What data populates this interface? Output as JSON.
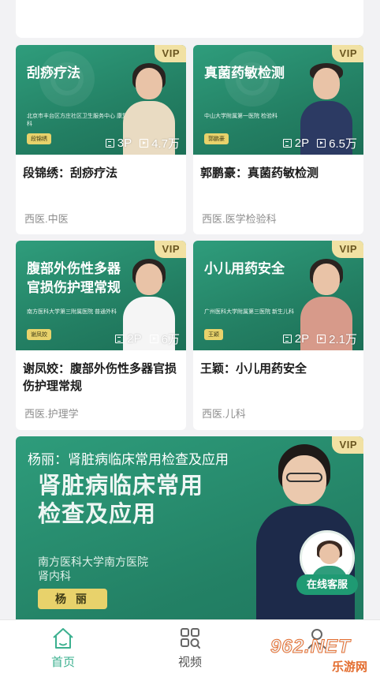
{
  "courses": [
    {
      "thumb_title": "刮痧疗法",
      "thumb_hospital": "北京市丰台区方庄社区卫生服务中心 康复科",
      "thumb_doctor": "段锦绣",
      "vip": "VIP",
      "parts": "3P",
      "views": "4.7万",
      "title": "段锦绣：刮痧疗法",
      "category": "西医.中医",
      "doctor_color": "#e9dbc2"
    },
    {
      "thumb_title": "真菌药敏检测",
      "thumb_hospital": "中山大学附属第一医院 检验科",
      "thumb_doctor": "郭鹏豪",
      "vip": "VIP",
      "parts": "2P",
      "views": "6.5万",
      "title": "郭鹏豪：真菌药敏检测",
      "category": "西医.医学检验科",
      "doctor_color": "#2c3a63"
    },
    {
      "thumb_title": "腹部外伤性多器官损伤护理常规",
      "thumb_hospital": "南方医科大学第三附属医院 普通外科",
      "thumb_doctor": "谢凤姣",
      "vip": "VIP",
      "parts": "2P",
      "views": "6万",
      "title": "谢凤姣：腹部外伤性多器官损伤护理常规",
      "category": "西医.护理学",
      "doctor_color": "#f5f5f5"
    },
    {
      "thumb_title": "小儿用药安全",
      "thumb_hospital": "广州医科大学附属第三医院 新生儿科",
      "thumb_doctor": "王颖",
      "vip": "VIP",
      "parts": "2P",
      "views": "2.1万",
      "title": "王颖：小儿用药安全",
      "category": "西医.儿科",
      "doctor_color": "#d79a8a"
    }
  ],
  "banner": {
    "top_title": "杨丽：肾脏病临床常用检查及应用",
    "big_title_line1": "肾脏病临床常用",
    "big_title_line2": "检查及应用",
    "hospital_line1": "南方医科大学南方医院",
    "hospital_line2": "肾内科",
    "doctor": "杨 丽",
    "vip": "VIP"
  },
  "customer_service": {
    "label": "在线客服"
  },
  "tabbar": {
    "home": "首页",
    "video": "视频"
  },
  "watermark": {
    "text": "962.NET",
    "sub": "乐游网"
  },
  "colors": {
    "accent": "#3bb08f",
    "card_green": "#2a8d6f",
    "vip_bg": "#f1e1a3"
  }
}
